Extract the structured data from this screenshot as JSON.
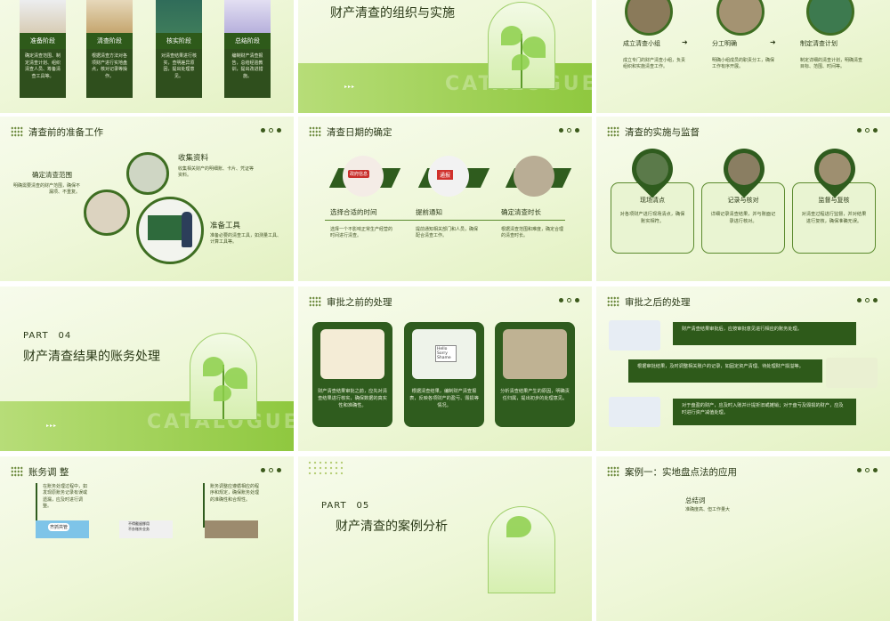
{
  "slides": {
    "s1": {
      "stages": [
        {
          "label": "准备阶段",
          "desc": "确定清查范围、制定清查计划、组织清查人员、筹备清查工具等。"
        },
        {
          "label": "清查阶段",
          "desc": "根据清查方法对各项财产进行实地盘点，核对记录等操作。"
        },
        {
          "label": "核实阶段",
          "desc": "对清查结果进行核实，查明差异原因，提出处理意见。"
        },
        {
          "label": "总结阶段",
          "desc": "编制财产清查报告，总结经验教训，提出改进措施。"
        }
      ]
    },
    "s2": {
      "title": "财产清查的组织与实施",
      "watermark": "CATALOGUE",
      "arrows": "▸▸▸"
    },
    "s3": {
      "steps": [
        {
          "label": "成立清查小组",
          "desc": "成立专门的财产清查小组，负责组织和实施清查工作。"
        },
        {
          "label": "分工明确",
          "desc": "明确小组成员的职责分工，确保工作有序开展。"
        },
        {
          "label": "制定清查计划",
          "desc": "制定详细的清查计划，明确清查目标、范围、时间等。"
        }
      ]
    },
    "s4": {
      "title": "清查前的准备工作",
      "collect_title": "收集资料",
      "collect_desc": "收集相关财产的明细账、卡片、凭证等资料。",
      "scope_title": "确定清查范围",
      "scope_desc": "明确需要清查的财产范围，确保不漏项、不重复。",
      "tools_title": "准备工具",
      "tools_desc": "准备必要的清查工具，如测量工具、计算工具等。"
    },
    "s5": {
      "title": "清查日期的确定",
      "items": [
        {
          "label": "选择合适的时间",
          "desc": "选择一个不影响正常生产经营的时间进行清查。"
        },
        {
          "label": "提前通知",
          "desc": "提前通知相关部门和人员，确保配合清查工作。"
        },
        {
          "label": "确定清查时长",
          "desc": "根据清查范围和难度，确定合理的清查时长。"
        }
      ],
      "badge1": "政府信息",
      "badge2": "通报"
    },
    "s6": {
      "title": "清查的实施与监督",
      "cards": [
        {
          "label": "现场清点",
          "desc": "对各项财产进行现场清点，确保账实相符。"
        },
        {
          "label": "记录与核对",
          "desc": "详细记录清查结果，并与账面记录进行核对。"
        },
        {
          "label": "监督与复核",
          "desc": "对清查过程进行监督，并对结果进行复核，确保准确无误。"
        }
      ]
    },
    "s7": {
      "part": "PART　04",
      "title": "财产清查结果的账务处理",
      "watermark": "CATALOGUE",
      "arrows": "▸▸▸"
    },
    "s8": {
      "title": "审批之前的处理",
      "tiles": [
        "财产清查结果审批之前，应先对清查结果进行核实，确保数据的真实性和准确性。",
        "根据清查结果，编制财产清查报表，反映各项财产的盈亏、毁损等情况。",
        "分析清查结果产生的原因，明确责任归属，提出初步的处理意见。"
      ],
      "sign": "Hello Sorry Shame"
    },
    "s9": {
      "title": "审批之后的处理",
      "rows": [
        "财产清查结果审批后，应按审批意见进行相应的账务处理。",
        "根据审批结果，及时调整相关账户的记录，如固定资产清理、待处理财产损溢等。",
        "对于盘盈的财产，应及时入账并计提折旧或摊销；对于盘亏及毁损的财产，应及时进行资产减值处理。"
      ]
    },
    "s10": {
      "title": "账务调 整",
      "left_desc": "在账务处理过程中，如发现原账务记录有误或遗漏，应及时进行调整。",
      "right_desc": "账务调整应遵循相应的程序和规定，确保账务处理的准确性和合规性。",
      "poster1": "齐抓共管",
      "poster2": "不得截留挪用\n不办账外业务"
    },
    "s11": {
      "part": "PART　05",
      "title": "财产清查的案例分析"
    },
    "s12": {
      "title": "案例一：实地盘点法的应用",
      "sub_title": "总结词",
      "sub_desc": "准确度高、但工作量大"
    }
  },
  "colors": {
    "dark_green": "#2f5c1e",
    "light_green": "#8fc83f",
    "background": "#eef7d8"
  }
}
